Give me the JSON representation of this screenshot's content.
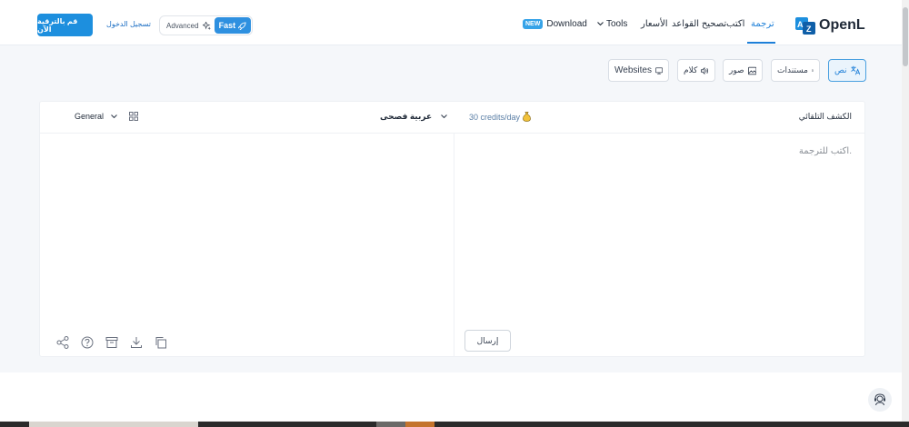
{
  "header": {
    "upgrade_label": "قم بالترقية الآن",
    "login_label": "تسجيل الدخول",
    "mode_advanced": "Advanced",
    "mode_fast": "Fast",
    "nav": {
      "download_badge": "NEW",
      "download": "Download",
      "tools": "Tools",
      "prices": "الأسعار",
      "grammar": "تصحيح القواعد",
      "write": "اكتب",
      "translate": "ترجمة"
    },
    "logo_mark": "AZ",
    "logo_text": "OpenL"
  },
  "tabs": {
    "websites": "Websites",
    "speech": "كلام",
    "images": "صور",
    "documents": "مستندات",
    "text": "نص"
  },
  "translator": {
    "style": "General",
    "target_language": "عربية فصحى",
    "credits": "30 credits/day",
    "source_language": "الكشف التلقائي",
    "source_placeholder": "اكتب للترجمة.",
    "send_label": "إرسال"
  },
  "colors": {
    "accent": "#1d8fde",
    "active_tab_bg": "#eaf4fc"
  }
}
